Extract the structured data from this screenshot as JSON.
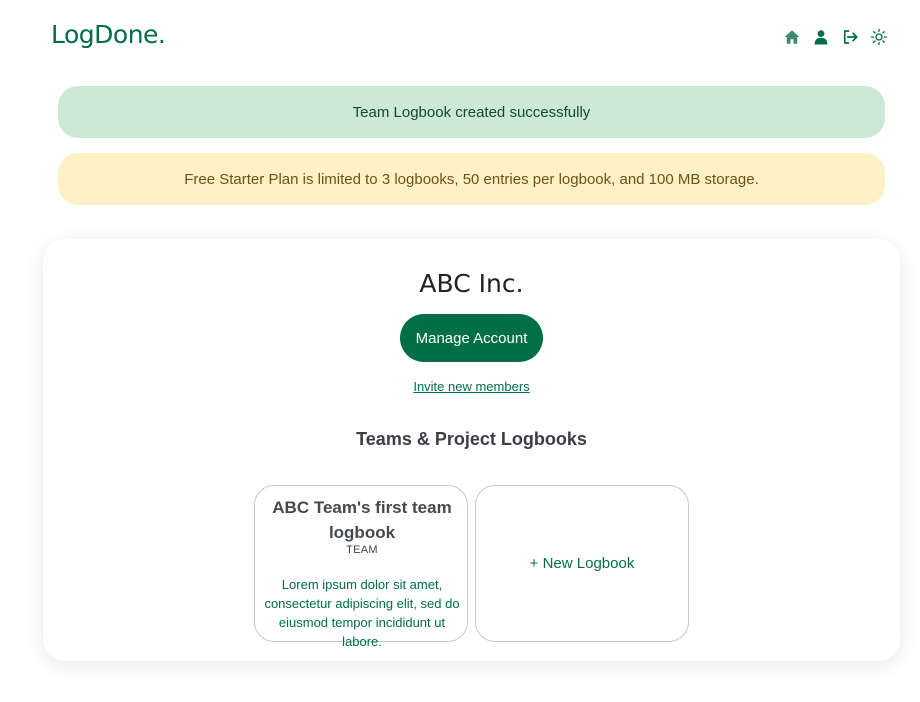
{
  "header": {
    "logo": "LogDone.",
    "nav": [
      {
        "icon": "home-icon"
      },
      {
        "icon": "user-icon"
      },
      {
        "icon": "logout-icon"
      },
      {
        "icon": "theme-toggle-icon"
      }
    ]
  },
  "alerts": {
    "success": "Team Logbook created successfully",
    "warning": "Free Starter Plan is limited to 3 logbooks, 50 entries per logbook, and 100 MB storage."
  },
  "account": {
    "name": "ABC Inc.",
    "manage_label": "Manage Account",
    "invite_label": "Invite new members"
  },
  "logbooks": {
    "section_title": "Teams & Project Logbooks",
    "items": [
      {
        "title": "ABC Team's first team logbook",
        "type": "TEAM",
        "description": "Lorem ipsum dolor sit amet, consectetur adipiscing elit, sed do eiusmod tempor incididunt ut labore."
      }
    ],
    "new_label": "+ New Logbook"
  },
  "colors": {
    "brand": "#006f45",
    "success_bg": "#cde9d6",
    "warning_bg": "#fff1c7"
  }
}
